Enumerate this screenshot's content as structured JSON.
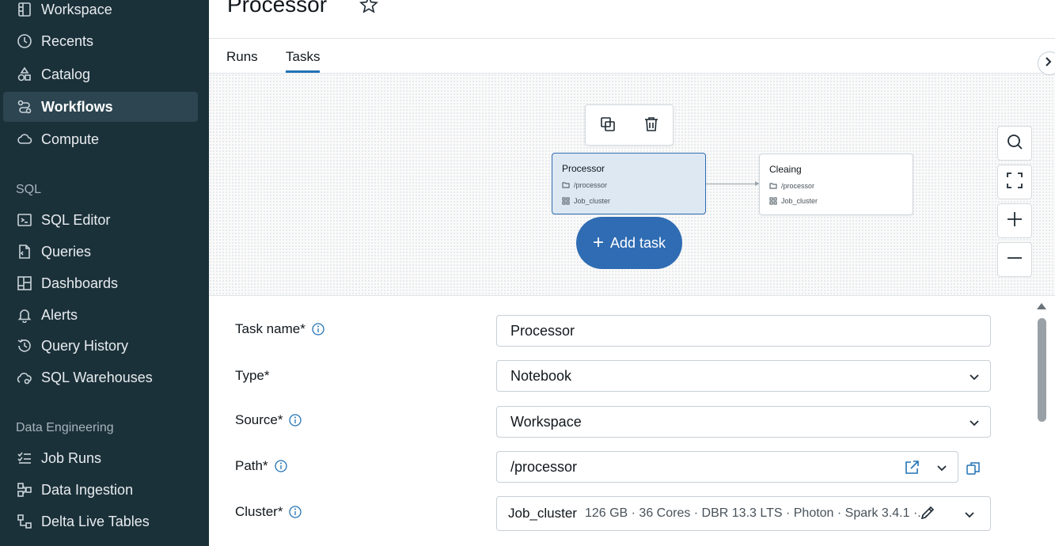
{
  "sidebar": {
    "items": [
      {
        "label": "Workspace",
        "icon": "workspace-icon"
      },
      {
        "label": "Recents",
        "icon": "clock-icon"
      },
      {
        "label": "Catalog",
        "icon": "catalog-icon"
      },
      {
        "label": "Workflows",
        "icon": "workflows-icon",
        "active": true
      },
      {
        "label": "Compute",
        "icon": "cloud-icon"
      }
    ],
    "sql_section": "SQL",
    "sql_items": [
      {
        "label": "SQL Editor",
        "icon": "terminal-icon"
      },
      {
        "label": "Queries",
        "icon": "query-file-icon"
      },
      {
        "label": "Dashboards",
        "icon": "dashboard-icon"
      },
      {
        "label": "Alerts",
        "icon": "bell-icon"
      },
      {
        "label": "Query History",
        "icon": "history-icon"
      },
      {
        "label": "SQL Warehouses",
        "icon": "warehouse-icon"
      }
    ],
    "de_section": "Data Engineering",
    "de_items": [
      {
        "label": "Job Runs",
        "icon": "list-check-icon"
      },
      {
        "label": "Data Ingestion",
        "icon": "ingestion-icon"
      },
      {
        "label": "Delta Live Tables",
        "icon": "pipeline-icon"
      }
    ]
  },
  "header": {
    "title": "Processor",
    "tabs": [
      {
        "label": "Runs"
      },
      {
        "label": "Tasks",
        "active": true
      }
    ]
  },
  "canvas": {
    "nodes": [
      {
        "title": "Processor",
        "path": "/processor",
        "cluster": "Job_cluster",
        "selected": true
      },
      {
        "title": "Cleaing",
        "path": "/processor",
        "cluster": "Job_cluster",
        "selected": false
      }
    ],
    "add_task_label": "Add task"
  },
  "form": {
    "task_name_label": "Task name*",
    "task_name_value": "Processor",
    "type_label": "Type*",
    "type_value": "Notebook",
    "source_label": "Source*",
    "source_value": "Workspace",
    "path_label": "Path*",
    "path_value": "/processor",
    "cluster_label": "Cluster*",
    "cluster_name": "Job_cluster",
    "cluster_specs": "126 GB · 36 Cores · DBR 13.3 LTS · Photon · Spark 3.4.1 ·..."
  },
  "colors": {
    "sidebar_bg": "#1b3139",
    "accent": "#2272b4",
    "add_task_bg": "#2f6cb3",
    "selected_node_bg": "#dde8f3"
  }
}
